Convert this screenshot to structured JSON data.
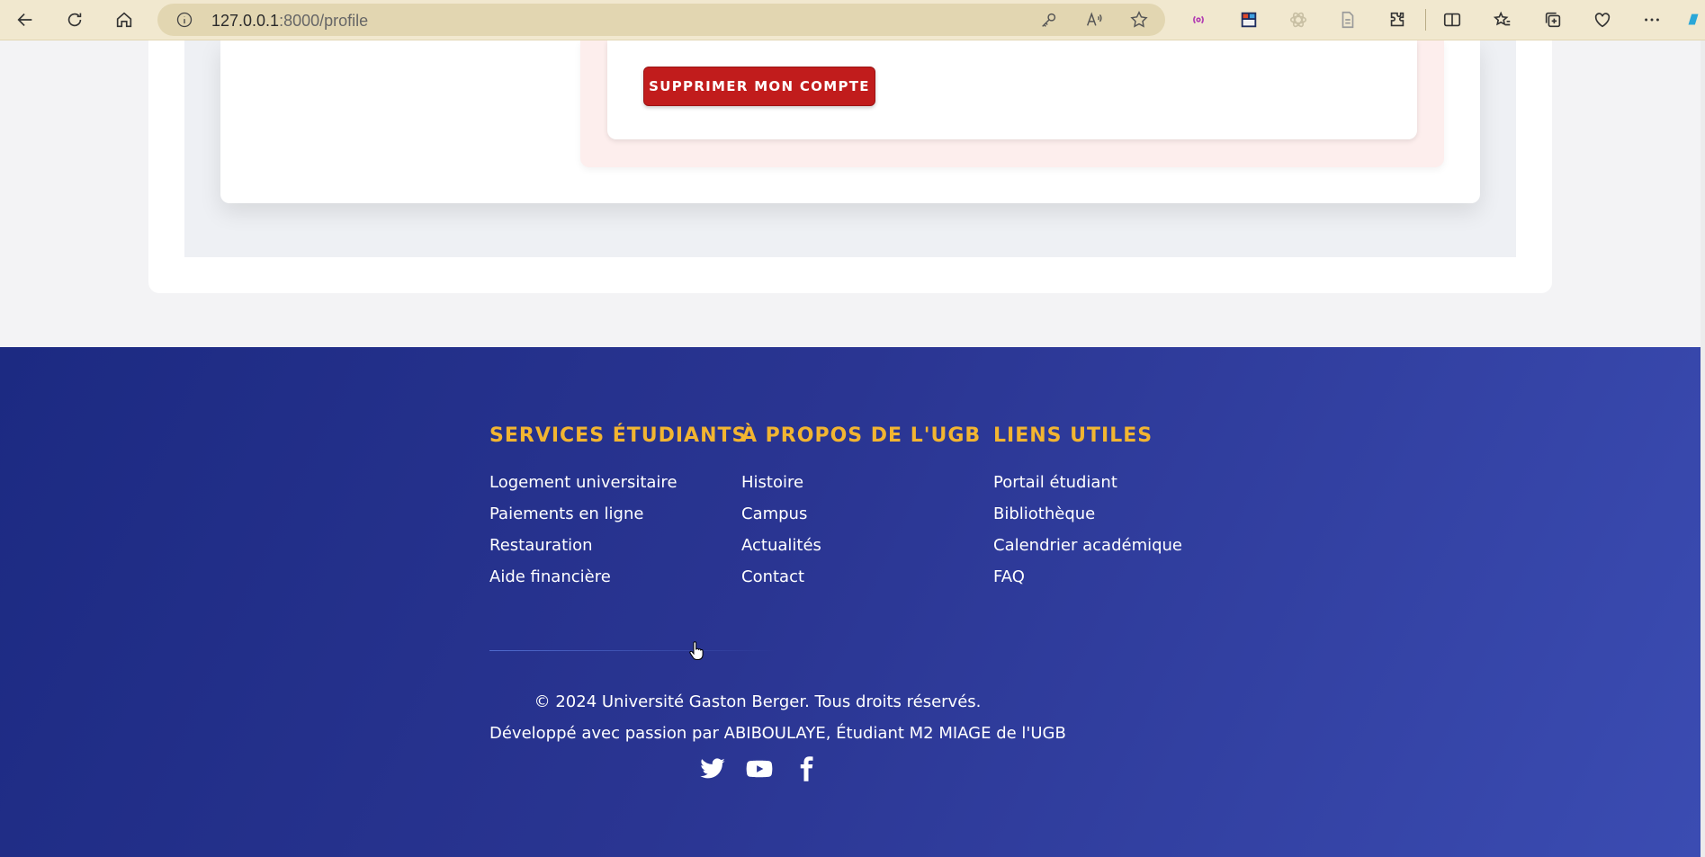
{
  "browser": {
    "url_host": "127.0.0.1",
    "url_path": ":8000/profile"
  },
  "danger_zone": {
    "delete_button_label": "SUPPRIMER MON COMPTE"
  },
  "footer": {
    "columns": [
      {
        "title": "SERVICES ÉTUDIANTS",
        "links": [
          "Logement universitaire",
          "Paiements en ligne",
          "Restauration",
          "Aide financière"
        ]
      },
      {
        "title": "À PROPOS DE L'UGB",
        "links": [
          "Histoire",
          "Campus",
          "Actualités",
          "Contact"
        ]
      },
      {
        "title": "LIENS UTILES",
        "links": [
          "Portail étudiant",
          "Bibliothèque",
          "Calendrier académique",
          "FAQ"
        ]
      }
    ],
    "copyright": "© 2024 Université Gaston Berger. Tous droits réservés.",
    "credits": "Développé avec passion par ABIBOULAYE, Étudiant M2 MIAGE de l'UGB",
    "socials": [
      "twitter-icon",
      "youtube-icon",
      "facebook-icon"
    ]
  },
  "colors": {
    "footer_gradient_start": "#1c2a82",
    "footer_gradient_end": "#3b4cb2",
    "footer_heading": "#f2b531",
    "danger_button": "#c11c1c",
    "danger_zone_bg": "#fdeeed"
  }
}
